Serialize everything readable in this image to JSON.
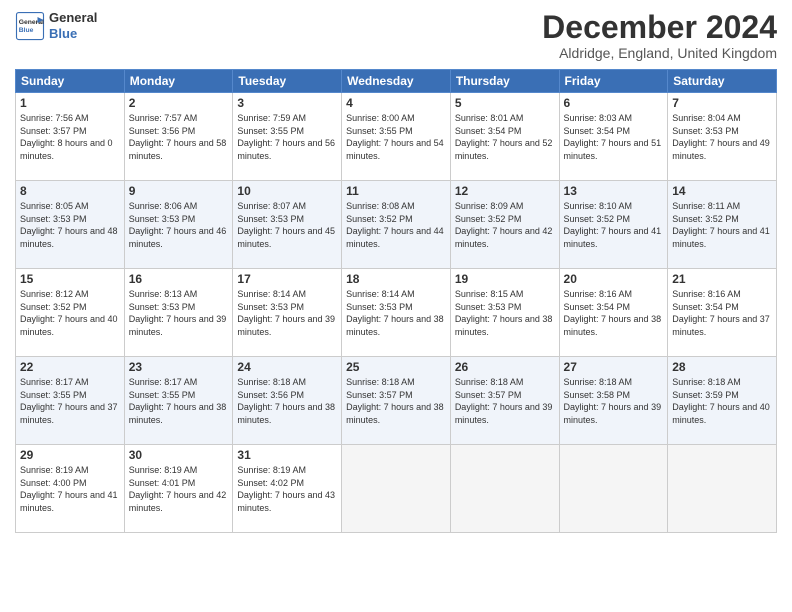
{
  "logo": {
    "line1": "General",
    "line2": "Blue"
  },
  "title": "December 2024",
  "subtitle": "Aldridge, England, United Kingdom",
  "headers": [
    "Sunday",
    "Monday",
    "Tuesday",
    "Wednesday",
    "Thursday",
    "Friday",
    "Saturday"
  ],
  "weeks": [
    [
      {
        "day": "1",
        "sunrise": "Sunrise: 7:56 AM",
        "sunset": "Sunset: 3:57 PM",
        "daylight": "Daylight: 8 hours and 0 minutes."
      },
      {
        "day": "2",
        "sunrise": "Sunrise: 7:57 AM",
        "sunset": "Sunset: 3:56 PM",
        "daylight": "Daylight: 7 hours and 58 minutes."
      },
      {
        "day": "3",
        "sunrise": "Sunrise: 7:59 AM",
        "sunset": "Sunset: 3:55 PM",
        "daylight": "Daylight: 7 hours and 56 minutes."
      },
      {
        "day": "4",
        "sunrise": "Sunrise: 8:00 AM",
        "sunset": "Sunset: 3:55 PM",
        "daylight": "Daylight: 7 hours and 54 minutes."
      },
      {
        "day": "5",
        "sunrise": "Sunrise: 8:01 AM",
        "sunset": "Sunset: 3:54 PM",
        "daylight": "Daylight: 7 hours and 52 minutes."
      },
      {
        "day": "6",
        "sunrise": "Sunrise: 8:03 AM",
        "sunset": "Sunset: 3:54 PM",
        "daylight": "Daylight: 7 hours and 51 minutes."
      },
      {
        "day": "7",
        "sunrise": "Sunrise: 8:04 AM",
        "sunset": "Sunset: 3:53 PM",
        "daylight": "Daylight: 7 hours and 49 minutes."
      }
    ],
    [
      {
        "day": "8",
        "sunrise": "Sunrise: 8:05 AM",
        "sunset": "Sunset: 3:53 PM",
        "daylight": "Daylight: 7 hours and 48 minutes."
      },
      {
        "day": "9",
        "sunrise": "Sunrise: 8:06 AM",
        "sunset": "Sunset: 3:53 PM",
        "daylight": "Daylight: 7 hours and 46 minutes."
      },
      {
        "day": "10",
        "sunrise": "Sunrise: 8:07 AM",
        "sunset": "Sunset: 3:53 PM",
        "daylight": "Daylight: 7 hours and 45 minutes."
      },
      {
        "day": "11",
        "sunrise": "Sunrise: 8:08 AM",
        "sunset": "Sunset: 3:52 PM",
        "daylight": "Daylight: 7 hours and 44 minutes."
      },
      {
        "day": "12",
        "sunrise": "Sunrise: 8:09 AM",
        "sunset": "Sunset: 3:52 PM",
        "daylight": "Daylight: 7 hours and 42 minutes."
      },
      {
        "day": "13",
        "sunrise": "Sunrise: 8:10 AM",
        "sunset": "Sunset: 3:52 PM",
        "daylight": "Daylight: 7 hours and 41 minutes."
      },
      {
        "day": "14",
        "sunrise": "Sunrise: 8:11 AM",
        "sunset": "Sunset: 3:52 PM",
        "daylight": "Daylight: 7 hours and 41 minutes."
      }
    ],
    [
      {
        "day": "15",
        "sunrise": "Sunrise: 8:12 AM",
        "sunset": "Sunset: 3:52 PM",
        "daylight": "Daylight: 7 hours and 40 minutes."
      },
      {
        "day": "16",
        "sunrise": "Sunrise: 8:13 AM",
        "sunset": "Sunset: 3:53 PM",
        "daylight": "Daylight: 7 hours and 39 minutes."
      },
      {
        "day": "17",
        "sunrise": "Sunrise: 8:14 AM",
        "sunset": "Sunset: 3:53 PM",
        "daylight": "Daylight: 7 hours and 39 minutes."
      },
      {
        "day": "18",
        "sunrise": "Sunrise: 8:14 AM",
        "sunset": "Sunset: 3:53 PM",
        "daylight": "Daylight: 7 hours and 38 minutes."
      },
      {
        "day": "19",
        "sunrise": "Sunrise: 8:15 AM",
        "sunset": "Sunset: 3:53 PM",
        "daylight": "Daylight: 7 hours and 38 minutes."
      },
      {
        "day": "20",
        "sunrise": "Sunrise: 8:16 AM",
        "sunset": "Sunset: 3:54 PM",
        "daylight": "Daylight: 7 hours and 38 minutes."
      },
      {
        "day": "21",
        "sunrise": "Sunrise: 8:16 AM",
        "sunset": "Sunset: 3:54 PM",
        "daylight": "Daylight: 7 hours and 37 minutes."
      }
    ],
    [
      {
        "day": "22",
        "sunrise": "Sunrise: 8:17 AM",
        "sunset": "Sunset: 3:55 PM",
        "daylight": "Daylight: 7 hours and 37 minutes."
      },
      {
        "day": "23",
        "sunrise": "Sunrise: 8:17 AM",
        "sunset": "Sunset: 3:55 PM",
        "daylight": "Daylight: 7 hours and 38 minutes."
      },
      {
        "day": "24",
        "sunrise": "Sunrise: 8:18 AM",
        "sunset": "Sunset: 3:56 PM",
        "daylight": "Daylight: 7 hours and 38 minutes."
      },
      {
        "day": "25",
        "sunrise": "Sunrise: 8:18 AM",
        "sunset": "Sunset: 3:57 PM",
        "daylight": "Daylight: 7 hours and 38 minutes."
      },
      {
        "day": "26",
        "sunrise": "Sunrise: 8:18 AM",
        "sunset": "Sunset: 3:57 PM",
        "daylight": "Daylight: 7 hours and 39 minutes."
      },
      {
        "day": "27",
        "sunrise": "Sunrise: 8:18 AM",
        "sunset": "Sunset: 3:58 PM",
        "daylight": "Daylight: 7 hours and 39 minutes."
      },
      {
        "day": "28",
        "sunrise": "Sunrise: 8:18 AM",
        "sunset": "Sunset: 3:59 PM",
        "daylight": "Daylight: 7 hours and 40 minutes."
      }
    ],
    [
      {
        "day": "29",
        "sunrise": "Sunrise: 8:19 AM",
        "sunset": "Sunset: 4:00 PM",
        "daylight": "Daylight: 7 hours and 41 minutes."
      },
      {
        "day": "30",
        "sunrise": "Sunrise: 8:19 AM",
        "sunset": "Sunset: 4:01 PM",
        "daylight": "Daylight: 7 hours and 42 minutes."
      },
      {
        "day": "31",
        "sunrise": "Sunrise: 8:19 AM",
        "sunset": "Sunset: 4:02 PM",
        "daylight": "Daylight: 7 hours and 43 minutes."
      },
      null,
      null,
      null,
      null
    ]
  ]
}
